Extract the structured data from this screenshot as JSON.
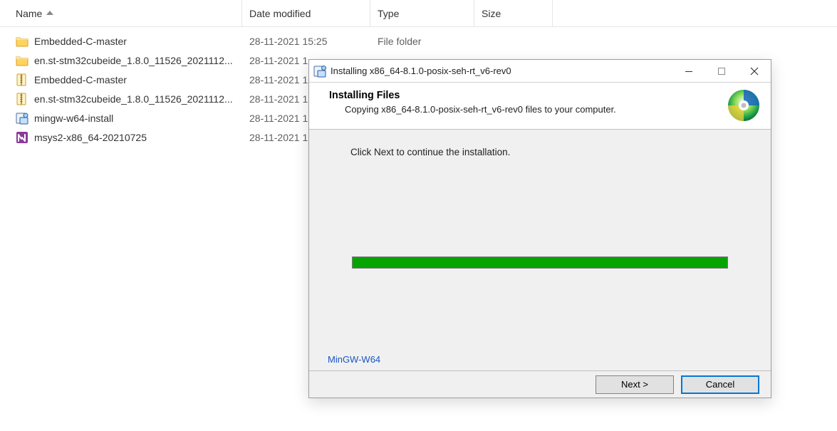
{
  "explorer": {
    "columns": {
      "name": {
        "label": "Name",
        "sort": "asc"
      },
      "date": {
        "label": "Date modified"
      },
      "type": {
        "label": "Type"
      },
      "size": {
        "label": "Size"
      }
    },
    "rows": [
      {
        "icon": "folder",
        "name": "Embedded-C-master",
        "date": "28-11-2021 15:25",
        "type": "File folder"
      },
      {
        "icon": "folder",
        "name": "en.st-stm32cubeide_1.8.0_11526_2021112...",
        "date": "28-11-2021 1",
        "type": ""
      },
      {
        "icon": "zip",
        "name": "Embedded-C-master",
        "date": "28-11-2021 1",
        "type": ""
      },
      {
        "icon": "zip",
        "name": "en.st-stm32cubeide_1.8.0_11526_2021112...",
        "date": "28-11-2021 1",
        "type": ""
      },
      {
        "icon": "installer",
        "name": "mingw-w64-install",
        "date": "28-11-2021 1",
        "type": ""
      },
      {
        "icon": "msys",
        "name": "msys2-x86_64-20210725",
        "date": "28-11-2021 1",
        "type": ""
      }
    ]
  },
  "dialog": {
    "title": "Installing x86_64-8.1.0-posix-seh-rt_v6-rev0",
    "heading": "Installing Files",
    "subtitle": "Copying x86_64-8.1.0-posix-seh-rt_v6-rev0 files to your computer.",
    "instruction": "Click Next to continue the installation.",
    "progress_percent": 100,
    "group_label": "MinGW-W64",
    "buttons": {
      "next": "Next >",
      "cancel": "Cancel"
    }
  }
}
